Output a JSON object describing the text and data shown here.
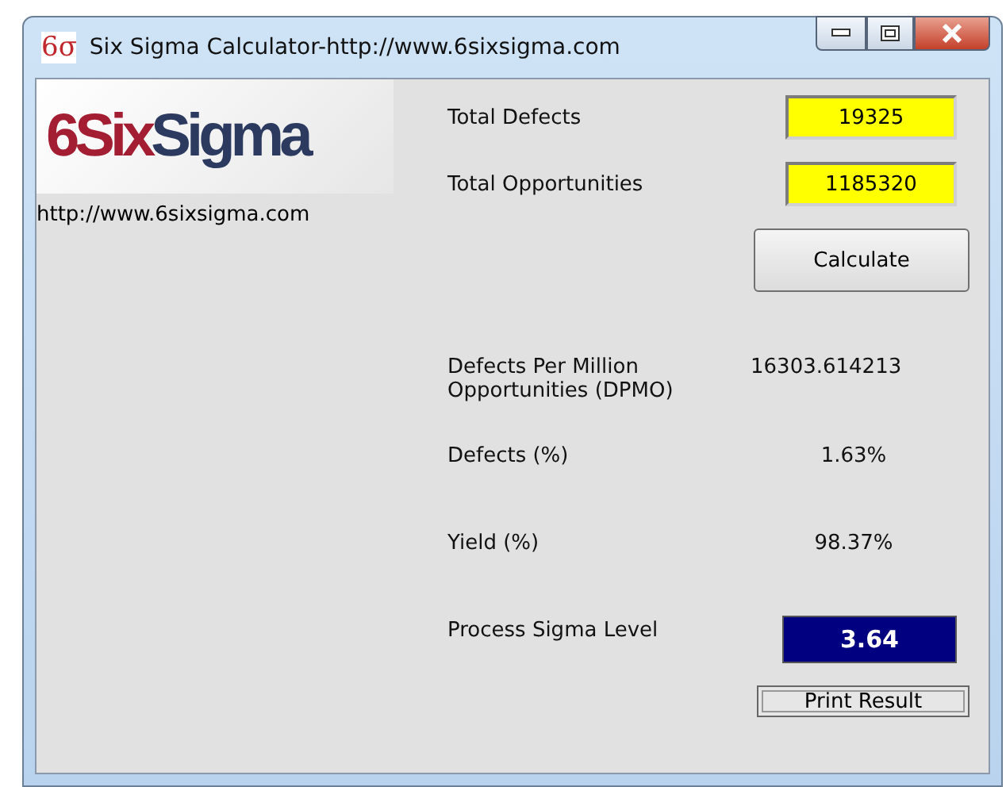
{
  "window": {
    "icon_text": "6σ",
    "title": "Six Sigma Calculator-http://www.6sixsigma.com"
  },
  "logo": {
    "part_1": "6Six",
    "part_2": "Sigma"
  },
  "website": "http://www.6sixsigma.com",
  "inputs": [
    {
      "label": "Total Defects",
      "value": "19325"
    },
    {
      "label": "Total Opportunities",
      "value": "1185320"
    }
  ],
  "calculate_button": "Calculate",
  "results": [
    {
      "kind": "plain",
      "label": "Defects Per Million Opportunities (DPMO)",
      "value": "16303.614213"
    },
    {
      "kind": "plain",
      "label": "Defects (%)",
      "value": "1.63%"
    },
    {
      "kind": "plain",
      "label": "Yield (%)",
      "value": "98.37%"
    },
    {
      "kind": "highlight",
      "label": "Process Sigma Level",
      "value": "3.64"
    }
  ],
  "print_button": "Print Result"
}
